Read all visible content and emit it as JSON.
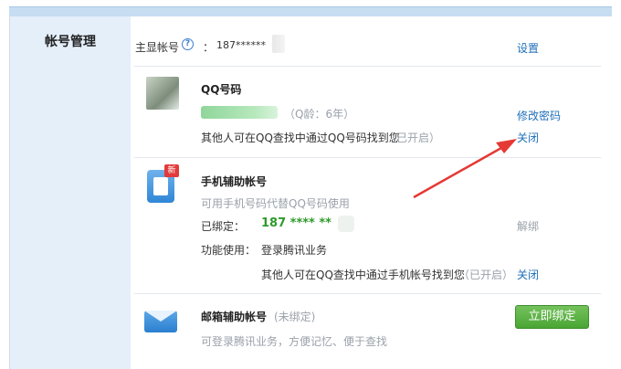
{
  "sidebar": {
    "title": "帐号管理"
  },
  "main_account": {
    "label": "主显帐号",
    "help": "?",
    "colon": "：",
    "value": "187******",
    "settings_link": "设置"
  },
  "qq": {
    "title": "QQ号码",
    "age": "（Q龄：6年）",
    "change_password": "修改密码",
    "findable_text": "其他人可在QQ查找中通过QQ号码找到您",
    "findable_status": "（已开启）",
    "close_link": "关闭"
  },
  "phone": {
    "badge": "新",
    "title": "手机辅助帐号",
    "description": "可用手机号码代替QQ号码使用",
    "bound_label": "已绑定：",
    "bound_value": "187 **** **",
    "unbind_link": "解绑",
    "function_label": "功能使用：",
    "function_value": "登录腾讯业务",
    "findable_text": "其他人可在QQ查找中通过手机帐号找到您",
    "findable_status": "（已开启）",
    "close_link": "关闭"
  },
  "email": {
    "title": "邮箱辅助帐号",
    "status": "(未绑定)",
    "description": "可登录腾讯业务，方便记忆、便于查找",
    "bind_button": "立即绑定"
  },
  "colors": {
    "link": "#1f6fb9",
    "green": "#2f9a2a",
    "sidebar_bg": "#e4effa",
    "arrow": "#e53935",
    "button": "#4aa534"
  }
}
